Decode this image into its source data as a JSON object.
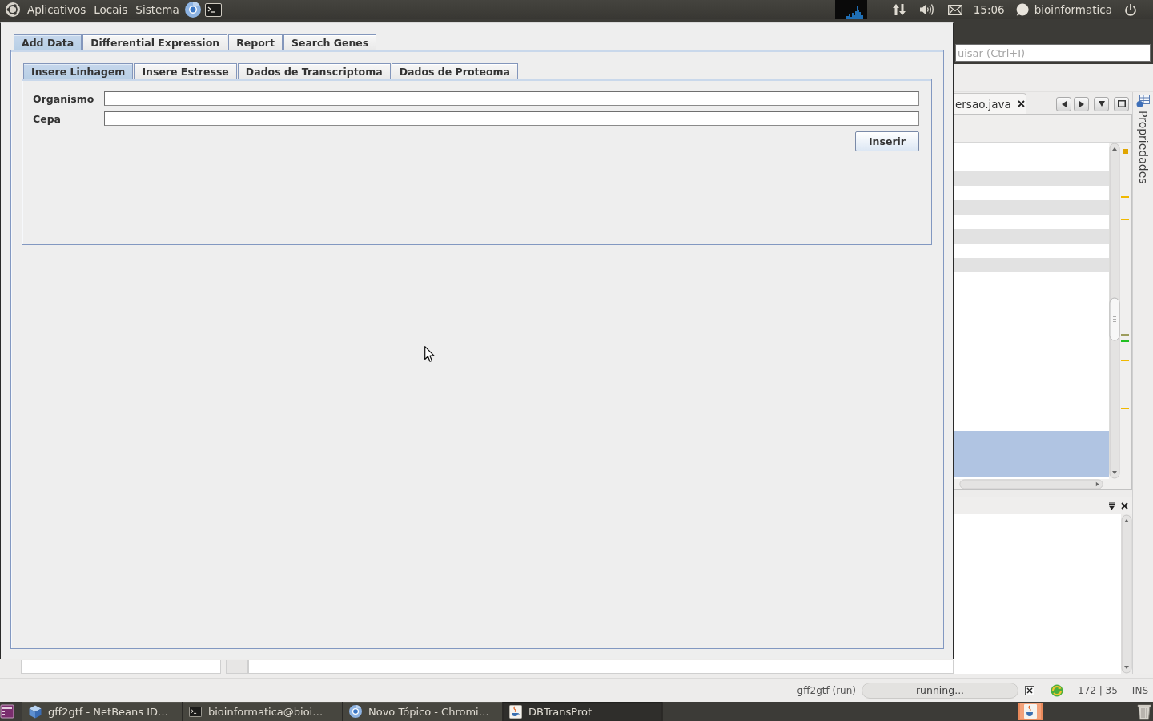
{
  "top_panel": {
    "menus": [
      {
        "label": "Aplicativos"
      },
      {
        "label": "Locais"
      },
      {
        "label": "Sistema"
      }
    ],
    "clock": "15:06",
    "user": "bioinformatica"
  },
  "app_window": {
    "tabs": [
      {
        "label": "Add Data",
        "selected": true
      },
      {
        "label": "Differential Expression",
        "selected": false
      },
      {
        "label": "Report",
        "selected": false
      },
      {
        "label": "Search Genes",
        "selected": false
      }
    ],
    "subtabs": [
      {
        "label": "Insere Linhagem",
        "selected": true
      },
      {
        "label": "Insere Estresse",
        "selected": false
      },
      {
        "label": "Dados de Transcriptoma",
        "selected": false
      },
      {
        "label": "Dados de Proteoma",
        "selected": false
      }
    ],
    "form": {
      "fields": [
        {
          "label": "Organismo"
        },
        {
          "label": "Cepa"
        }
      ],
      "submit": "Inserir"
    }
  },
  "ide_window": {
    "search": {
      "placeholder": "uisar (Ctrl+I)"
    },
    "editor_tab": {
      "label": "ersao.java"
    },
    "side_panel": {
      "label": "Propriedades"
    },
    "status_bar": {
      "task": "gff2gtf (run)",
      "progress": "running...",
      "position": "172 | 35",
      "mode": "INS"
    }
  },
  "taskbar": {
    "items": [
      {
        "kind": "ide",
        "label": "gff2gtf - NetBeans ID…",
        "selected": false
      },
      {
        "kind": "terminal",
        "label": "bioinformatica@bioi…",
        "selected": false
      },
      {
        "kind": "browser",
        "label": "Novo Tópico - Chromi…",
        "selected": false
      },
      {
        "kind": "java",
        "label": "DBTransProt",
        "selected": true
      }
    ]
  }
}
